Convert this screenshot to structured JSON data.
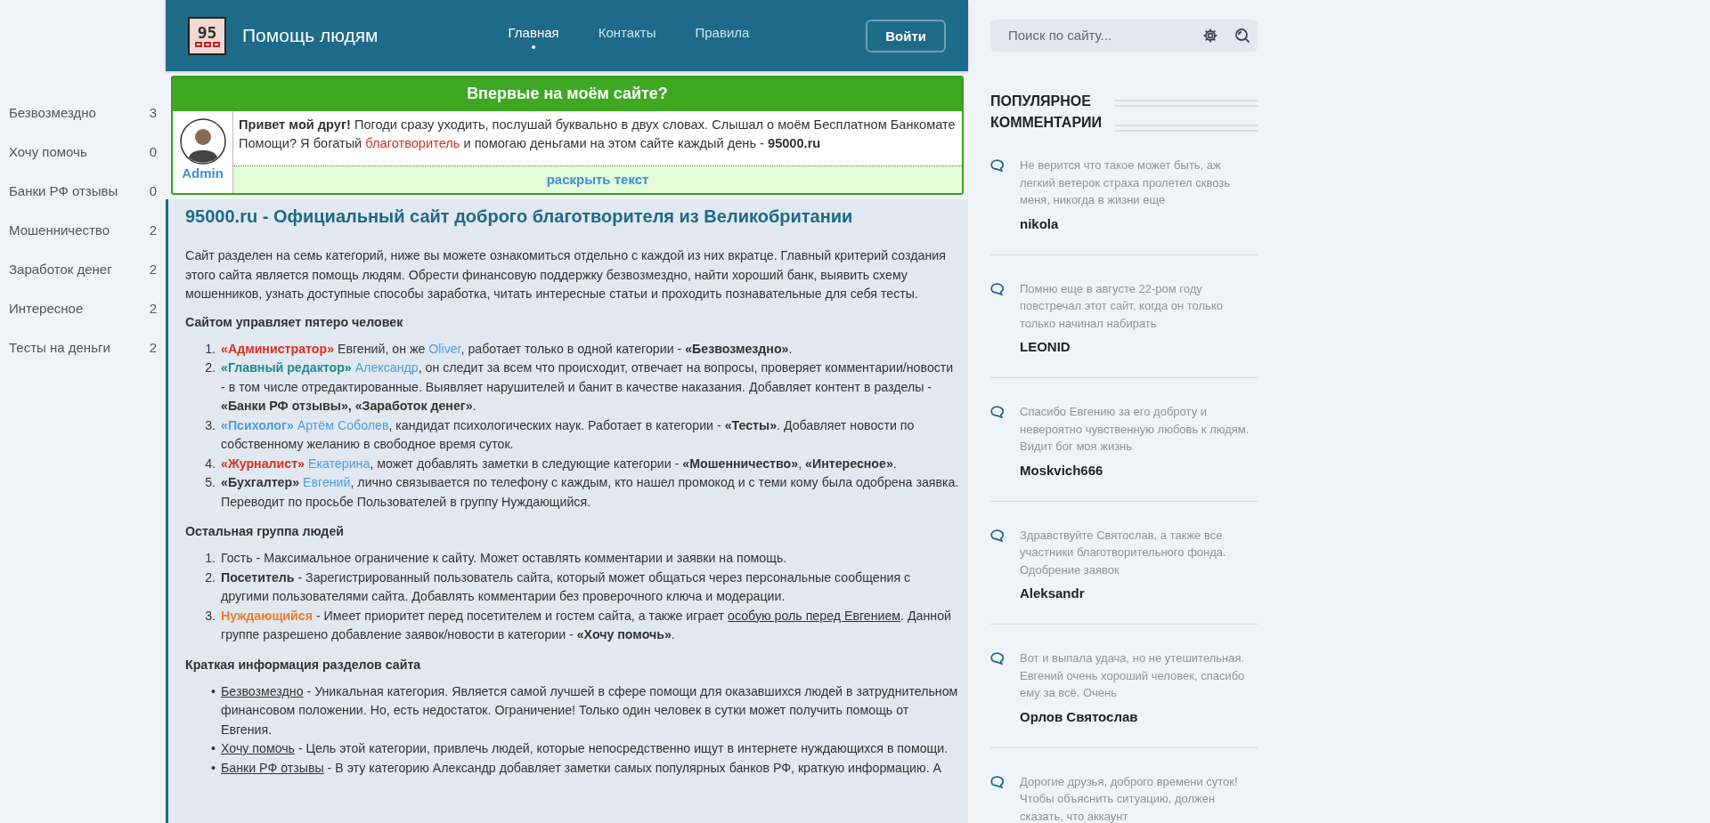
{
  "sidebar": {
    "categories": [
      {
        "label": "Безвозмездно",
        "count": "3"
      },
      {
        "label": "Хочу помочь",
        "count": "0"
      },
      {
        "label": "Банки РФ отзывы",
        "count": "0"
      },
      {
        "label": "Мошенничество",
        "count": "2"
      },
      {
        "label": "Заработок денег",
        "count": "2"
      },
      {
        "label": "Интересное",
        "count": "2"
      },
      {
        "label": "Тесты на деньги",
        "count": "2"
      }
    ]
  },
  "header": {
    "logo_text": "95",
    "site_title": "Помощь людям",
    "nav": [
      {
        "label": "Главная",
        "selected": true
      },
      {
        "label": "Контакты",
        "selected": false
      },
      {
        "label": "Правила",
        "selected": false
      }
    ],
    "login_button": "Войти"
  },
  "welcome": {
    "title": "Впервые на моём сайте?",
    "author": "Admin",
    "intro": [
      {
        "text": "Привет мой друг!",
        "kind": "bold"
      },
      {
        "text": " Погоди сразу уходить, послушай буквально в двух словах. Слышал о моём Бесплатном Банкомате Помощи? Я богатый ",
        "kind": "plain"
      },
      {
        "text": "благотворитель",
        "kind": "link-red"
      },
      {
        "text": " и помогаю деньгами на этом сайте каждый день - ",
        "kind": "plain"
      },
      {
        "text": "95000.ru",
        "kind": "bold"
      }
    ],
    "expand_link": "раскрыть текст"
  },
  "article": {
    "title": "95000.ru - Официальный сайт доброго благотворителя из Великобритании",
    "intro": "Сайт разделен на семь категорий, ниже вы можете ознакомиться отдельно с каждой из них вкратце. Главный критерий создания этого сайта является помощь людям. Обрести финансовую поддержку безвозмездно, найти хороший банк, выявить схему мошенников, узнать доступные способы заработка, читать интересные статьи и проходить познавательные для себя тесты.",
    "blocks": [
      {
        "kind": "heading",
        "text": "Сайтом управляет пятеро человек"
      },
      {
        "kind": "list",
        "items": [
          {
            "marker": "1.",
            "segments": [
              {
                "text": "«Администратор»",
                "kind": "role-red"
              },
              {
                "text": " Евгений, он же ",
                "kind": "plain"
              },
              {
                "text": "Oliver",
                "kind": "link"
              },
              {
                "text": ", работает только в одной категории - ",
                "kind": "plain"
              },
              {
                "text": "«Безвозмездно»",
                "kind": "bold"
              },
              {
                "text": ".",
                "kind": "plain"
              }
            ]
          },
          {
            "marker": "2.",
            "segments": [
              {
                "text": "«Главный редактор» ",
                "kind": "role-teal"
              },
              {
                "text": "Александр",
                "kind": "link"
              },
              {
                "text": ", он следит за всем что происходит, отвечает на вопросы, проверяет комментарии/новости - в том числе отредактированные. Выявляет нарушителей и банит в качестве наказания. Добавляет контент в разделы - ",
                "kind": "plain"
              },
              {
                "text": "«Банки РФ отзывы», «Заработок денег»",
                "kind": "bold"
              },
              {
                "text": ".",
                "kind": "plain"
              }
            ]
          },
          {
            "marker": "3.",
            "segments": [
              {
                "text": "«Психолог» ",
                "kind": "role-blue"
              },
              {
                "text": "Артём Соболев",
                "kind": "link"
              },
              {
                "text": ", кандидат психологических наук. Работает в категории - ",
                "kind": "plain"
              },
              {
                "text": "«Тесты»",
                "kind": "bold"
              },
              {
                "text": ". Добавляет новости по собственному желанию в свободное время суток.",
                "kind": "plain"
              }
            ]
          },
          {
            "marker": "4.",
            "segments": [
              {
                "text": "«Журналист» ",
                "kind": "role-red"
              },
              {
                "text": "Екатерина",
                "kind": "link"
              },
              {
                "text": ", может добавлять заметки в следующие категории - ",
                "kind": "plain"
              },
              {
                "text": "«Мошенничество»",
                "kind": "bold"
              },
              {
                "text": ", ",
                "kind": "plain"
              },
              {
                "text": "«Интересное»",
                "kind": "bold"
              },
              {
                "text": ".",
                "kind": "plain"
              }
            ]
          },
          {
            "marker": "5.",
            "segments": [
              {
                "text": "«Бухгалтер» ",
                "kind": "bold"
              },
              {
                "text": "Евгений",
                "kind": "link"
              },
              {
                "text": ", лично связывается по телефону с каждым, кто нашел промокод и с теми кому была одобрена заявка. Переводит по просьбе Пользователей в группу Нуждающийся.",
                "kind": "plain"
              }
            ]
          }
        ]
      },
      {
        "kind": "heading",
        "text": "Остальная группа людей"
      },
      {
        "kind": "list",
        "items": [
          {
            "marker": "1.",
            "segments": [
              {
                "text": "Гость - Максимальное ограничение к сайту. Может оставлять комментарии и заявки на помощь.",
                "kind": "plain"
              }
            ]
          },
          {
            "marker": "2.",
            "segments": [
              {
                "text": "Посетитель",
                "kind": "bold"
              },
              {
                "text": " - Зарегистрированный пользователь сайта, который может общаться через персональные сообщения с другими пользователями сайта. Добавлять комментарии без проверочного ключа и модерации.",
                "kind": "plain"
              }
            ]
          },
          {
            "marker": "3.",
            "segments": [
              {
                "text": "Нуждающийся",
                "kind": "role-orange"
              },
              {
                "text": " - Имеет приоритет перед посетителем и гостем сайта, а также играет ",
                "kind": "plain"
              },
              {
                "text": "особую роль перед Евгением",
                "kind": "link-underline"
              },
              {
                "text": ". Данной группе разрешено добавление заявок/новости в категории - ",
                "kind": "plain"
              },
              {
                "text": "«Хочу помочь»",
                "kind": "bold"
              },
              {
                "text": ".",
                "kind": "plain"
              }
            ]
          }
        ]
      },
      {
        "kind": "heading",
        "text": "Краткая информация разделов сайта"
      },
      {
        "kind": "list",
        "items": [
          {
            "marker": "•",
            "segments": [
              {
                "text": "Безвозмездно",
                "kind": "link-underline"
              },
              {
                "text": " - Уникальная категория. Является самой лучшей в сфере помощи для оказавшихся людей в затруднительном финансовом положении. Но, есть недостаток. Ограничение! Только один человек в сутки может получить помощь от Евгения.",
                "kind": "plain"
              }
            ]
          },
          {
            "marker": "•",
            "segments": [
              {
                "text": "Хочу помочь",
                "kind": "link-underline"
              },
              {
                "text": " - Цель этой категории, привлечь людей, которые непосредственно ищут в интернете нуждающихся в помощи.",
                "kind": "plain"
              }
            ]
          },
          {
            "marker": "•",
            "segments": [
              {
                "text": "Банки РФ отзывы",
                "kind": "link-underline"
              },
              {
                "text": " - В эту категорию Александр добавляет заметки самых популярных банков РФ, краткую информацию. А",
                "kind": "plain"
              }
            ]
          }
        ]
      }
    ]
  },
  "search": {
    "placeholder": "Поиск по сайту..."
  },
  "popular": {
    "title": "ПОПУЛЯРНОЕ КОММЕНТАРИИ",
    "comments": [
      {
        "text": "Не верится что такое может быть, аж легкий ветерок страха пролетел сквозь меня, никогда в жизни еще",
        "author": "nikola"
      },
      {
        "text": "Помню еще в августе 22-ром году повстречал этот сайт, когда он только только начинал набирать",
        "author": "LEONID"
      },
      {
        "text": "Спасибо Евгению за его доброту и невероятно чувственную любовь к людям. Видит бог моя жизнь",
        "author": "Moskvich666"
      },
      {
        "text": "Здравствуйте Святослав, а также все участники благотворительного фонда. Одобрение заявок",
        "author": "Aleksandr"
      },
      {
        "text": "Вот и выпала удача, но не утешительная. Евгений очень хороший человек, спасибо ему за всё. Очень",
        "author": "Орлов Святослав"
      },
      {
        "text": "Дорогие друзья, доброго времени суток! Чтобы объяснить ситуацию, должен сказать, что аккаунт"
      }
    ]
  }
}
